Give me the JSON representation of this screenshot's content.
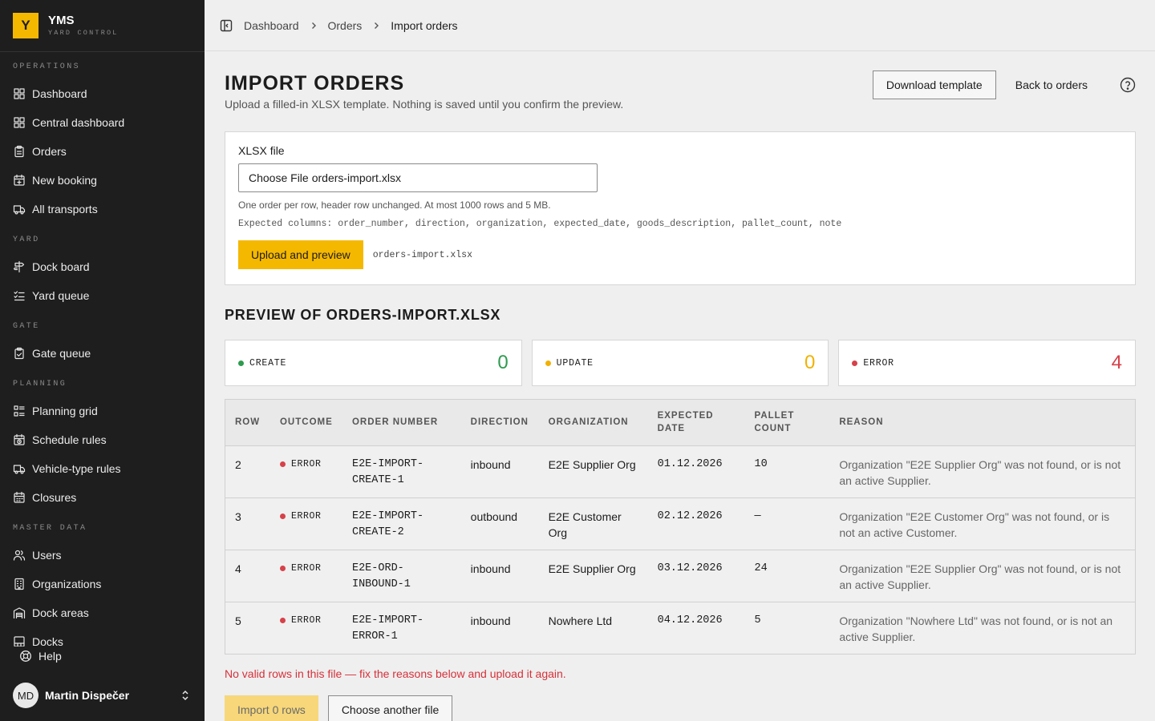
{
  "brand": {
    "logo": "Y",
    "name": "YMS",
    "subtitle": "YARD CONTROL"
  },
  "sidebar": {
    "sections": [
      {
        "title": "OPERATIONS",
        "items": [
          {
            "label": "Dashboard",
            "icon": "grid-icon"
          },
          {
            "label": "Central dashboard",
            "icon": "grid-icon"
          },
          {
            "label": "Orders",
            "icon": "clipboard-icon"
          },
          {
            "label": "New booking",
            "icon": "calendar-plus-icon"
          },
          {
            "label": "All transports",
            "icon": "truck-icon"
          }
        ]
      },
      {
        "title": "YARD",
        "items": [
          {
            "label": "Dock board",
            "icon": "signpost-icon"
          },
          {
            "label": "Yard queue",
            "icon": "list-checks-icon"
          }
        ]
      },
      {
        "title": "GATE",
        "items": [
          {
            "label": "Gate queue",
            "icon": "clipboard-check-icon"
          }
        ]
      },
      {
        "title": "PLANNING",
        "items": [
          {
            "label": "Planning grid",
            "icon": "grid-list-icon"
          },
          {
            "label": "Schedule rules",
            "icon": "calendar-clock-icon"
          },
          {
            "label": "Vehicle-type rules",
            "icon": "truck-icon"
          },
          {
            "label": "Closures",
            "icon": "calendar-icon"
          }
        ]
      },
      {
        "title": "MASTER DATA",
        "items": [
          {
            "label": "Users",
            "icon": "users-icon"
          },
          {
            "label": "Organizations",
            "icon": "building-icon"
          },
          {
            "label": "Dock areas",
            "icon": "warehouse-icon"
          },
          {
            "label": "Docks",
            "icon": "dock-icon"
          }
        ]
      }
    ],
    "help_label": "Help",
    "user": {
      "initials": "MD",
      "name": "Martin Dispečer"
    }
  },
  "breadcrumb": {
    "items": [
      "Dashboard",
      "Orders"
    ],
    "current": "Import orders"
  },
  "header": {
    "title": "IMPORT ORDERS",
    "subtitle": "Upload a filled-in XLSX template. Nothing is saved until you confirm the preview.",
    "download_label": "Download template",
    "back_label": "Back to orders"
  },
  "upload": {
    "label": "XLSX file",
    "choose_label": "Choose File",
    "file_name": "orders-import.xlsx",
    "hint": "One order per row, header row unchanged. At most 1000 rows and 5 MB.",
    "columns_hint": "Expected columns: order_number, direction, organization, expected_date, goods_description, pallet_count, note",
    "upload_label": "Upload and preview",
    "selected_file": "orders-import.xlsx"
  },
  "preview": {
    "title": "PREVIEW OF ORDERS-IMPORT.XLSX",
    "stats": [
      {
        "label": "CREATE",
        "value": "0",
        "color": "#2e9b4f"
      },
      {
        "label": "UPDATE",
        "value": "0",
        "color": "#f2b100"
      },
      {
        "label": "ERROR",
        "value": "4",
        "color": "#d6414a"
      }
    ],
    "columns": [
      "ROW",
      "OUTCOME",
      "ORDER NUMBER",
      "DIRECTION",
      "ORGANIZATION",
      "EXPECTED DATE",
      "PALLET COUNT",
      "REASON"
    ],
    "rows": [
      {
        "row": "2",
        "outcome": "ERROR",
        "order_number": "E2E-IMPORT-CREATE-1",
        "direction": "inbound",
        "organization": "E2E Supplier Org",
        "expected_date": "01.12.2026",
        "pallet_count": "10",
        "reason": "Organization \"E2E Supplier Org\" was not found, or is not an active Supplier."
      },
      {
        "row": "3",
        "outcome": "ERROR",
        "order_number": "E2E-IMPORT-CREATE-2",
        "direction": "outbound",
        "organization": "E2E Customer Org",
        "expected_date": "02.12.2026",
        "pallet_count": "—",
        "reason": "Organization \"E2E Customer Org\" was not found, or is not an active Customer."
      },
      {
        "row": "4",
        "outcome": "ERROR",
        "order_number": "E2E-ORD-INBOUND-1",
        "direction": "inbound",
        "organization": "E2E Supplier Org",
        "expected_date": "03.12.2026",
        "pallet_count": "24",
        "reason": "Organization \"E2E Supplier Org\" was not found, or is not an active Supplier."
      },
      {
        "row": "5",
        "outcome": "ERROR",
        "order_number": "E2E-IMPORT-ERROR-1",
        "direction": "inbound",
        "organization": "Nowhere Ltd",
        "expected_date": "04.12.2026",
        "pallet_count": "5",
        "reason": "Organization \"Nowhere Ltd\" was not found, or is not an active Supplier."
      }
    ],
    "error_note": "No valid rows in this file — fix the reasons below and upload it again.",
    "import_label": "Import 0 rows",
    "choose_another_label": "Choose another file"
  },
  "colors": {
    "accent": "#f5b800",
    "sidebar_bg": "#1e1e1e",
    "error": "#d6313a"
  }
}
